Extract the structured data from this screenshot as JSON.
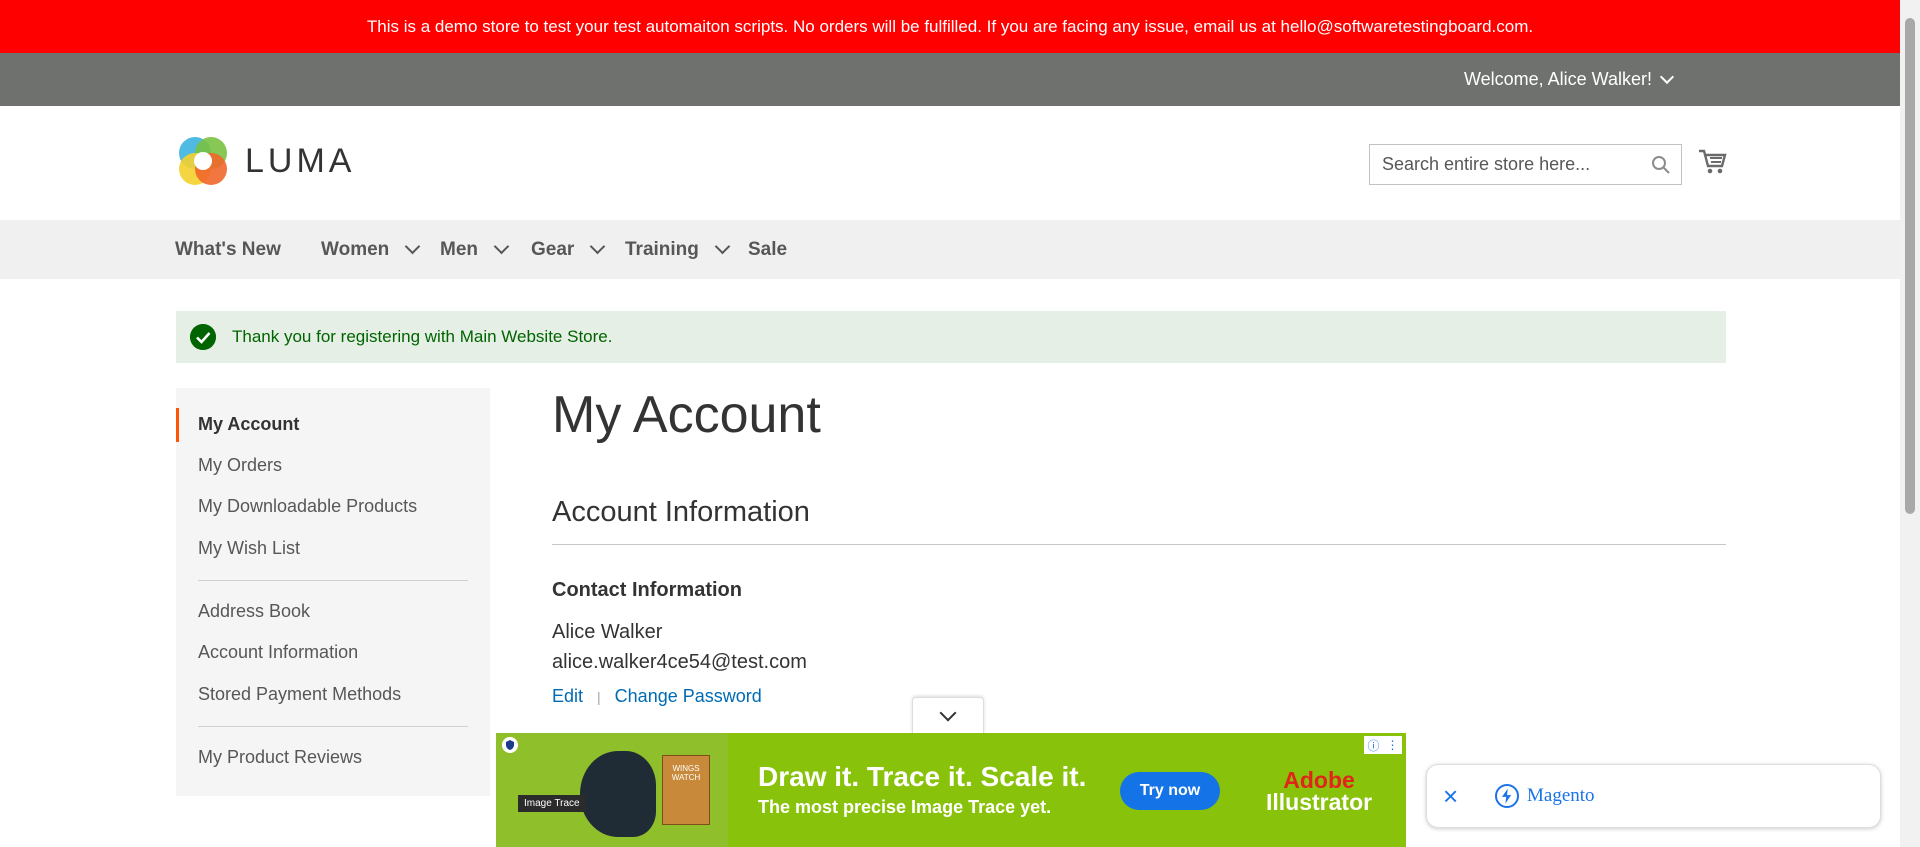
{
  "demo_notice": "This is a demo store to test your test automaiton scripts. No orders will be fulfilled. If you are facing any issue, email us at hello@softwaretestingboard.com.",
  "header": {
    "welcome": "Welcome, Alice Walker!",
    "logo_text": "LUMA",
    "search_placeholder": "Search entire store here..."
  },
  "nav": {
    "items": [
      {
        "label": "What's New"
      },
      {
        "label": "Women"
      },
      {
        "label": "Men"
      },
      {
        "label": "Gear"
      },
      {
        "label": "Training"
      },
      {
        "label": "Sale"
      }
    ]
  },
  "message": "Thank you for registering with Main Website Store.",
  "sidebar": {
    "items": [
      {
        "label": "My Account"
      },
      {
        "label": "My Orders"
      },
      {
        "label": "My Downloadable Products"
      },
      {
        "label": "My Wish List"
      },
      {
        "label": "Address Book"
      },
      {
        "label": "Account Information"
      },
      {
        "label": "Stored Payment Methods"
      },
      {
        "label": "My Product Reviews"
      }
    ]
  },
  "main": {
    "page_title": "My Account",
    "block_title": "Account Information",
    "contact_title": "Contact Information",
    "name": "Alice Walker",
    "email": "alice.walker4ce54@test.com",
    "edit_label": "Edit",
    "separator": "|",
    "change_password_label": "Change Password"
  },
  "ad": {
    "image_tag": "Image Trace",
    "book_title": "WINGS WATCH",
    "headline": "Draw it. Trace it. Scale it.",
    "subline": "The most precise Image Trace yet.",
    "cta": "Try now",
    "brand_line1": "Adobe",
    "brand_line2": "Illustrator"
  },
  "toast": {
    "label": "Magento"
  }
}
